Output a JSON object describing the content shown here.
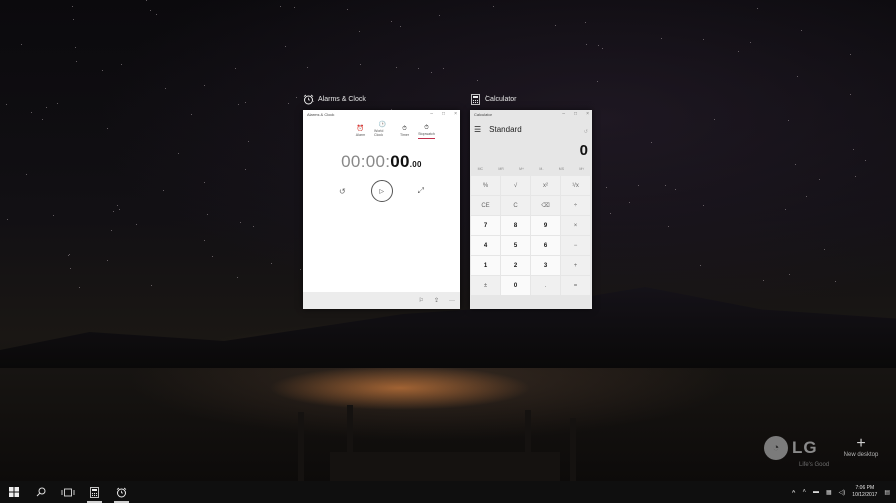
{
  "task_view": {
    "windows": [
      {
        "app_name": "Alarms & Clock",
        "icon": "alarm-clock-icon",
        "window_title": "Alarms & Clock",
        "tabs": [
          {
            "label": "Alarm",
            "icon": "alarm-icon"
          },
          {
            "label": "World Clock",
            "icon": "world-clock-icon"
          },
          {
            "label": "Timer",
            "icon": "timer-icon"
          },
          {
            "label": "Stopwatch",
            "icon": "stopwatch-icon",
            "active": true
          }
        ],
        "stopwatch": {
          "hours": "00",
          "minutes": "00",
          "seconds": "00",
          "fraction": ".00",
          "sep": ":"
        }
      },
      {
        "app_name": "Calculator",
        "icon": "calculator-icon",
        "window_title": "Calculator",
        "mode": "Standard",
        "display": "0",
        "memory_buttons": [
          "MC",
          "MR",
          "M+",
          "M-",
          "MS",
          "M˅"
        ],
        "keys": [
          "%",
          "√",
          "x²",
          "¹/x",
          "CE",
          "C",
          "⌫",
          "÷",
          "7",
          "8",
          "9",
          "×",
          "4",
          "5",
          "6",
          "−",
          "1",
          "2",
          "3",
          "+",
          "±",
          "0",
          ".",
          "="
        ]
      }
    ]
  },
  "watermark": {
    "brand": "LG",
    "slogan": "Life's Good"
  },
  "new_desktop": {
    "label": "New desktop"
  },
  "taskbar": {
    "clock_time": "7:06 PM",
    "clock_date": "10/12/2017"
  },
  "colors": {
    "accent": "#c0304c",
    "taskbar": "#0f0f0f"
  }
}
